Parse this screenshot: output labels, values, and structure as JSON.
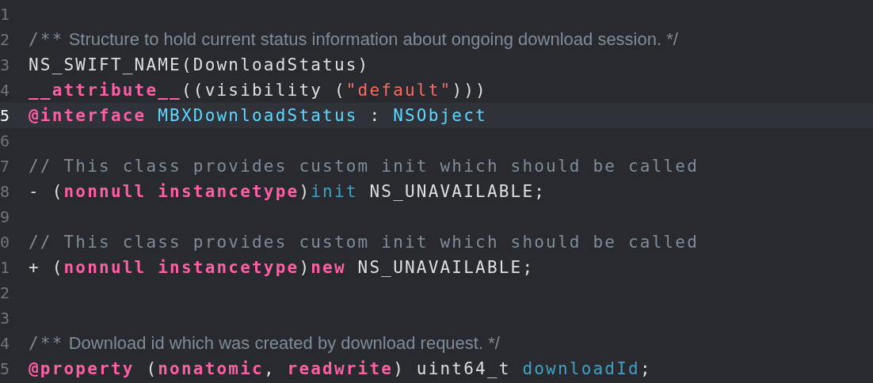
{
  "editor": {
    "lines": [
      {
        "number": "1",
        "current": false
      },
      {
        "number": "2",
        "current": false,
        "tokens": [
          {
            "kind": "comment",
            "text": "/**"
          },
          {
            "kind": "doc",
            "text": " Structure to hold current status information about ongoing download session. */"
          }
        ]
      },
      {
        "number": "3",
        "current": false,
        "tokens": [
          {
            "kind": "plain",
            "text": "NS_SWIFT_NAME(DownloadStatus)"
          }
        ]
      },
      {
        "number": "4",
        "current": false,
        "tokens": [
          {
            "kind": "keyword",
            "text": "__attribute__"
          },
          {
            "kind": "plain",
            "text": "((visibility ("
          },
          {
            "kind": "string",
            "text": "\"default\""
          },
          {
            "kind": "plain",
            "text": ")))"
          }
        ]
      },
      {
        "number": "5",
        "current": true,
        "tokens": [
          {
            "kind": "keyword",
            "text": "@interface"
          },
          {
            "kind": "type",
            "text": " MBXDownloadStatus"
          },
          {
            "kind": "plain",
            "text": " : "
          },
          {
            "kind": "type",
            "text": "NSObject"
          }
        ]
      },
      {
        "number": "6",
        "current": false
      },
      {
        "number": "7",
        "current": false,
        "tokens": [
          {
            "kind": "comment",
            "text": "// This class provides custom init which should be called"
          }
        ]
      },
      {
        "number": "8",
        "current": false,
        "tokens": [
          {
            "kind": "plain",
            "text": "- ("
          },
          {
            "kind": "keyword",
            "text": "nonnull instancetype"
          },
          {
            "kind": "plain",
            "text": ")"
          },
          {
            "kind": "method",
            "text": "init"
          },
          {
            "kind": "plain",
            "text": " NS_UNAVAILABLE;"
          }
        ]
      },
      {
        "number": "9",
        "current": false
      },
      {
        "number": "0",
        "current": false,
        "tokens": [
          {
            "kind": "comment",
            "text": "// This class provides custom init which should be called"
          }
        ]
      },
      {
        "number": "1",
        "current": false,
        "tokens": [
          {
            "kind": "plain",
            "text": "+ ("
          },
          {
            "kind": "keyword",
            "text": "nonnull instancetype"
          },
          {
            "kind": "plain",
            "text": ")"
          },
          {
            "kind": "keyword",
            "text": "new"
          },
          {
            "kind": "plain",
            "text": " NS_UNAVAILABLE;"
          }
        ]
      },
      {
        "number": "2",
        "current": false
      },
      {
        "number": "3",
        "current": false
      },
      {
        "number": "4",
        "current": false,
        "tokens": [
          {
            "kind": "comment",
            "text": "/**"
          },
          {
            "kind": "doc",
            "text": " Download id which was created by download request. */"
          }
        ]
      },
      {
        "number": "5",
        "current": false,
        "tokens": [
          {
            "kind": "keyword",
            "text": "@property"
          },
          {
            "kind": "plain",
            "text": " ("
          },
          {
            "kind": "keyword",
            "text": "nonatomic"
          },
          {
            "kind": "plain",
            "text": ", "
          },
          {
            "kind": "keyword",
            "text": "readwrite"
          },
          {
            "kind": "plain",
            "text": ") uint64_t "
          },
          {
            "kind": "method",
            "text": "downloadId"
          },
          {
            "kind": "plain",
            "text": ";"
          }
        ]
      }
    ]
  }
}
